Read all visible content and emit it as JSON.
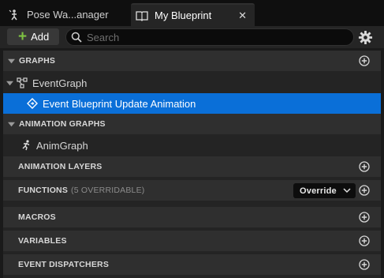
{
  "tabs": [
    {
      "label": "Pose Wa...anager",
      "active": false
    },
    {
      "label": "My Blueprint",
      "active": true
    }
  ],
  "toolbar": {
    "add_label": "Add",
    "search_placeholder": "Search"
  },
  "sections": {
    "graphs": {
      "title": "GRAPHS"
    },
    "animation_graphs": {
      "title": "ANIMATION GRAPHS"
    },
    "animation_layers": {
      "title": "ANIMATION LAYERS"
    },
    "functions": {
      "title": "FUNCTIONS",
      "note": "(5 OVERRIDABLE)",
      "override_label": "Override"
    },
    "macros": {
      "title": "MACROS"
    },
    "variables": {
      "title": "VARIABLES"
    },
    "event_dispatchers": {
      "title": "EVENT DISPATCHERS"
    }
  },
  "items": {
    "event_graph": "EventGraph",
    "blueprint_update": "Event Blueprint Update Animation",
    "anim_graph": "AnimGraph"
  },
  "colors": {
    "selection": "#0a6fd8",
    "add_plus": "#7ec242",
    "section_header": "#2f2f2f",
    "panel_bg": "#242424"
  },
  "icons": [
    "pose-asset-icon",
    "blueprint-book-icon",
    "close-icon",
    "plus-icon",
    "search-icon",
    "gear-icon",
    "collapse-arrow-icon",
    "event-graph-icon",
    "event-node-icon",
    "running-figure-icon",
    "plus-circle-icon",
    "chevron-down-icon"
  ]
}
